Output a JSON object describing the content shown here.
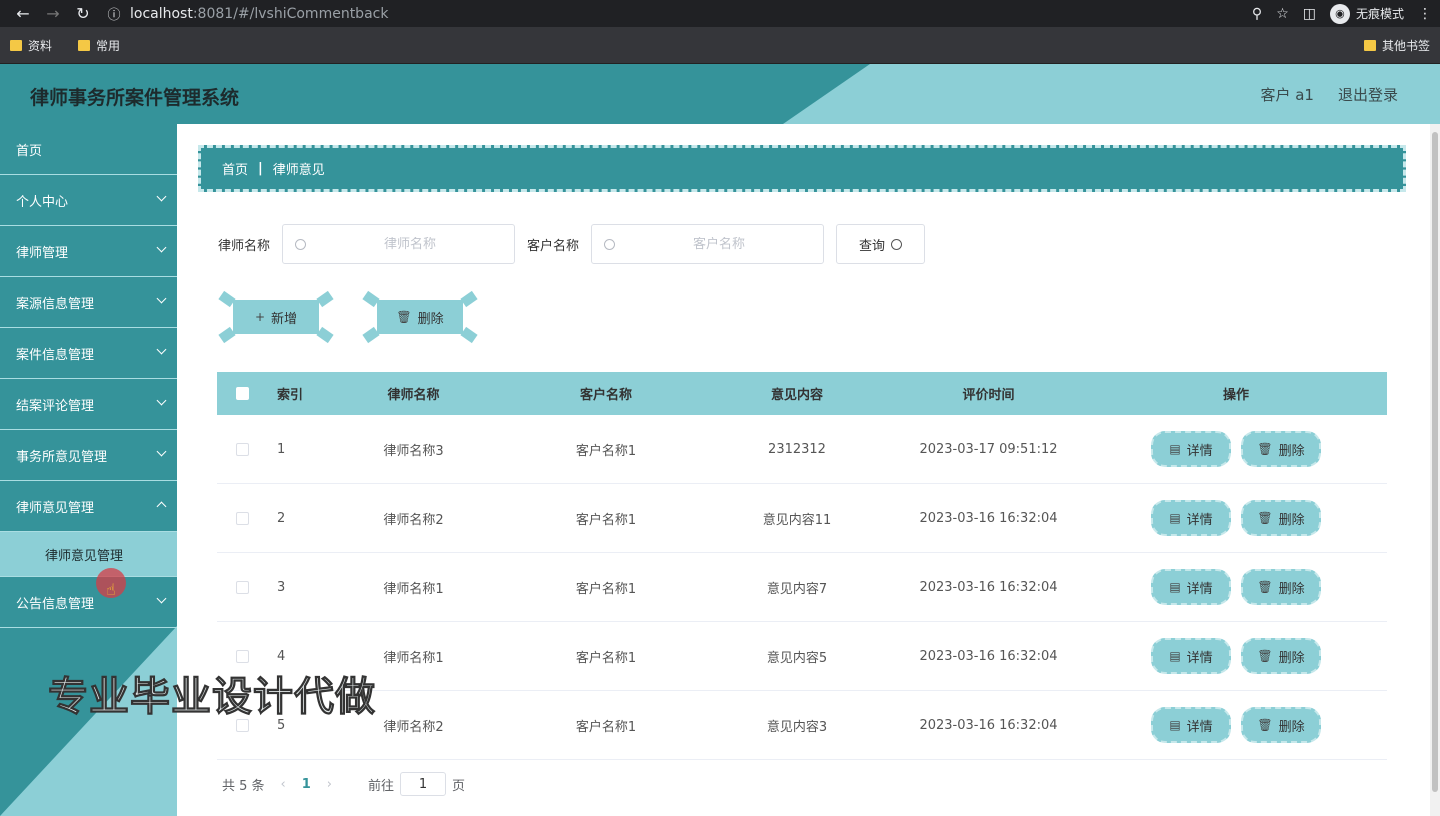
{
  "browser": {
    "url_host": "localhost",
    "url_path": ":8081/#/lvshiCommentback",
    "incognito_label": "无痕模式",
    "bookmarks": [
      "资料",
      "常用"
    ],
    "other_bookmarks": "其他书签"
  },
  "header": {
    "title": "律师事务所案件管理系统",
    "user": "客户 a1",
    "logout": "退出登录"
  },
  "sidebar": {
    "items": [
      {
        "label": "首页",
        "has_chevron": false
      },
      {
        "label": "个人中心",
        "has_chevron": true
      },
      {
        "label": "律师管理",
        "has_chevron": true
      },
      {
        "label": "案源信息管理",
        "has_chevron": true
      },
      {
        "label": "案件信息管理",
        "has_chevron": true
      },
      {
        "label": "结案评论管理",
        "has_chevron": true
      },
      {
        "label": "事务所意见管理",
        "has_chevron": true
      },
      {
        "label": "律师意见管理",
        "has_chevron": true,
        "open": true
      },
      {
        "label": "公告信息管理",
        "has_chevron": true
      }
    ],
    "submenu": "律师意见管理"
  },
  "breadcrumb": {
    "home": "首页",
    "separator": "|",
    "current": "律师意见"
  },
  "search": {
    "lawyer_label": "律师名称",
    "lawyer_placeholder": "律师名称",
    "client_label": "客户名称",
    "client_placeholder": "客户名称",
    "query": "查询"
  },
  "actions": {
    "add": "新增",
    "delete": "删除"
  },
  "table": {
    "headers": {
      "index": "索引",
      "lawyer": "律师名称",
      "client": "客户名称",
      "content": "意见内容",
      "time": "评价时间",
      "ops": "操作"
    },
    "detail_label": "详情",
    "delete_label": "删除",
    "rows": [
      {
        "index": "1",
        "lawyer": "律师名称3",
        "client": "客户名称1",
        "content": "2312312",
        "time": "2023-03-17 09:51:12"
      },
      {
        "index": "2",
        "lawyer": "律师名称2",
        "client": "客户名称1",
        "content": "意见内容11",
        "time": "2023-03-16 16:32:04"
      },
      {
        "index": "3",
        "lawyer": "律师名称1",
        "client": "客户名称1",
        "content": "意见内容7",
        "time": "2023-03-16 16:32:04"
      },
      {
        "index": "4",
        "lawyer": "律师名称1",
        "client": "客户名称1",
        "content": "意见内容5",
        "time": "2023-03-16 16:32:04"
      },
      {
        "index": "5",
        "lawyer": "律师名称2",
        "client": "客户名称1",
        "content": "意见内容3",
        "time": "2023-03-16 16:32:04"
      }
    ]
  },
  "pagination": {
    "total": "共 5 条",
    "current_page": "1",
    "goto_label": "前往",
    "goto_value": "1",
    "page_suffix": "页"
  },
  "watermark": "专业毕业设计代做",
  "colors": {
    "dark_teal": "#35939a",
    "light_teal": "#8ccfd6"
  }
}
